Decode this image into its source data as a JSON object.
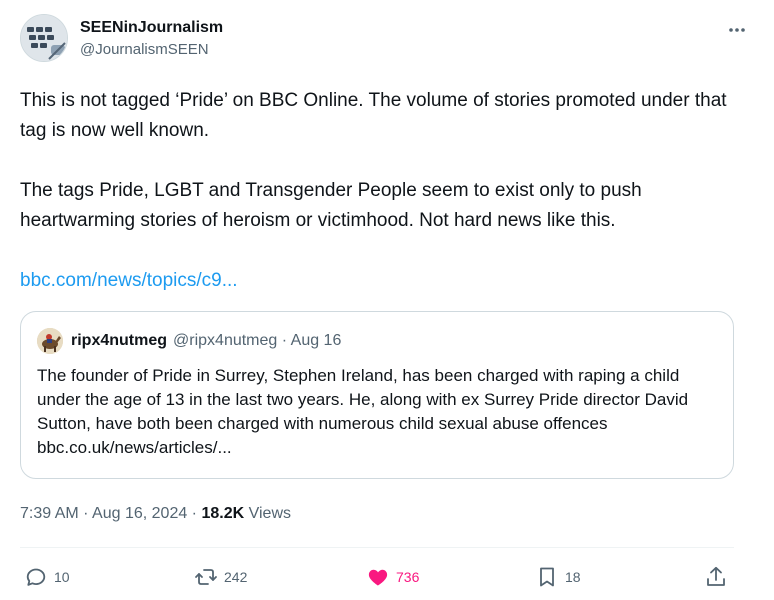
{
  "author": {
    "display_name": "SEENinJournalism",
    "handle": "@JournalismSEEN",
    "avatar_icon": "keyboard-avatar"
  },
  "more_icon": "more-icon",
  "tweet": {
    "paragraph1": "This is not tagged ‘Pride’ on BBC Online.  The volume of stories promoted under that tag is now well known.",
    "paragraph2": "The tags Pride, LGBT and Transgender People seem to exist only to push heartwarming stories of heroism or victimhood. Not hard news like this.",
    "link": "bbc.com/news/topics/c9..."
  },
  "quote": {
    "display_name": "ripx4nutmeg",
    "meta": "@ripx4nutmeg · Aug 16",
    "text": "The founder of Pride in Surrey, Stephen Ireland, has been charged with raping a child under the age of 13 in the last two years. He, along with ex Surrey Pride director David Sutton, have both been charged with numerous child sexual abuse offences bbc.co.uk/news/articles/..."
  },
  "timestamp": {
    "time_date": "7:39 AM · Aug 16, 2024 · ",
    "views_count": "18.2K",
    "views_label": " Views"
  },
  "actions": {
    "replies": "10",
    "reposts": "242",
    "likes": "736",
    "bookmarks": "18"
  },
  "colors": {
    "link": "#1d9bf0",
    "like": "#f91880",
    "secondary_text": "#536471",
    "border": "#cfd9de"
  }
}
